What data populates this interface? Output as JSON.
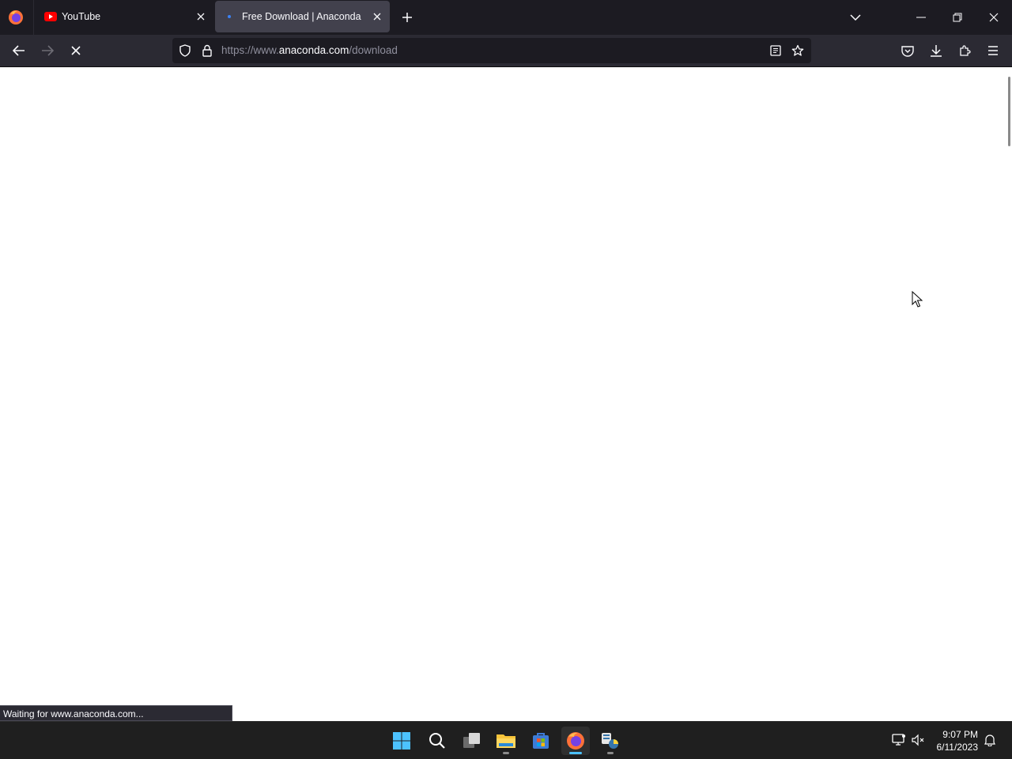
{
  "browser": {
    "tabs": [
      {
        "title": "YouTube",
        "active": false
      },
      {
        "title": "Free Download | Anaconda",
        "active": true
      }
    ],
    "url": {
      "scheme": "https://www.",
      "host": "anaconda.com",
      "path": "/download"
    },
    "status_text": "Waiting for www.anaconda.com..."
  },
  "taskbar": {
    "time": "9:07 PM",
    "date": "6/11/2023"
  },
  "colors": {
    "accent": "#4cc2ff",
    "tab_active": "#42414d",
    "toolbar": "#2b2a33",
    "tabstrip": "#1c1b22",
    "youtube_red": "#ff0000"
  },
  "icons": [
    "firefox-icon",
    "youtube-icon",
    "close-icon",
    "plus-icon",
    "chevron-down-icon",
    "minimize-icon",
    "restore-icon",
    "back-icon",
    "forward-icon",
    "stop-icon",
    "shield-icon",
    "lock-icon",
    "reader-icon",
    "star-icon",
    "pocket-icon",
    "download-icon",
    "extensions-icon",
    "menu-icon",
    "windows-start-icon",
    "search-icon",
    "task-view-icon",
    "file-explorer-icon",
    "store-icon",
    "python-icon",
    "network-icon",
    "notification-icon"
  ]
}
